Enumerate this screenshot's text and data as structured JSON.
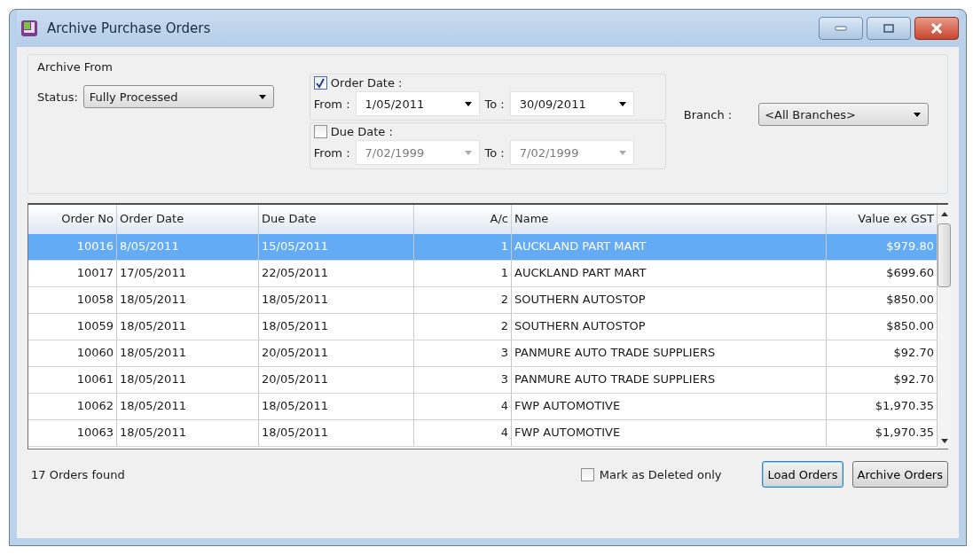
{
  "window": {
    "title": "Archive Purchase Orders"
  },
  "filters": {
    "group_title": "Archive From",
    "status": {
      "label": "Status:",
      "value": "Fully Processed"
    },
    "order_date": {
      "label": "Order Date :",
      "checked": true,
      "from_label": "From :",
      "from": "1/05/2011",
      "to_label": "To :",
      "to": "30/09/2011"
    },
    "due_date": {
      "label": "Due Date :",
      "checked": false,
      "from_label": "From :",
      "from": "7/02/1999",
      "to_label": "To :",
      "to": "7/02/1999"
    },
    "branch": {
      "label": "Branch :",
      "value": "<All Branches>"
    }
  },
  "table": {
    "columns": [
      "Order No",
      "Order Date",
      "Due Date",
      "A/c",
      "Name",
      "Value ex GST"
    ],
    "rows": [
      {
        "selected": true,
        "cells": [
          "10016",
          "8/05/2011",
          "15/05/2011",
          "1",
          "AUCKLAND PART MART",
          "$979.80"
        ]
      },
      {
        "selected": false,
        "cells": [
          "10017",
          "17/05/2011",
          "22/05/2011",
          "1",
          "AUCKLAND PART MART",
          "$699.60"
        ]
      },
      {
        "selected": false,
        "cells": [
          "10058",
          "18/05/2011",
          "18/05/2011",
          "2",
          "SOUTHERN AUTOSTOP",
          "$850.00"
        ]
      },
      {
        "selected": false,
        "cells": [
          "10059",
          "18/05/2011",
          "18/05/2011",
          "2",
          "SOUTHERN AUTOSTOP",
          "$850.00"
        ]
      },
      {
        "selected": false,
        "cells": [
          "10060",
          "18/05/2011",
          "20/05/2011",
          "3",
          "PANMURE AUTO TRADE SUPPLIERS",
          "$92.70"
        ]
      },
      {
        "selected": false,
        "cells": [
          "10061",
          "18/05/2011",
          "20/05/2011",
          "3",
          "PANMURE AUTO TRADE SUPPLIERS",
          "$92.70"
        ]
      },
      {
        "selected": false,
        "cells": [
          "10062",
          "18/05/2011",
          "18/05/2011",
          "4",
          "FWP AUTOMOTIVE",
          "$1,970.35"
        ]
      },
      {
        "selected": false,
        "cells": [
          "10063",
          "18/05/2011",
          "18/05/2011",
          "4",
          "FWP AUTOMOTIVE",
          "$1,970.35"
        ]
      }
    ]
  },
  "footer": {
    "status": "17 Orders found",
    "mark_deleted": {
      "label": "Mark as Deleted only",
      "checked": false
    },
    "buttons": [
      "Load Orders",
      "Archive Orders"
    ]
  }
}
